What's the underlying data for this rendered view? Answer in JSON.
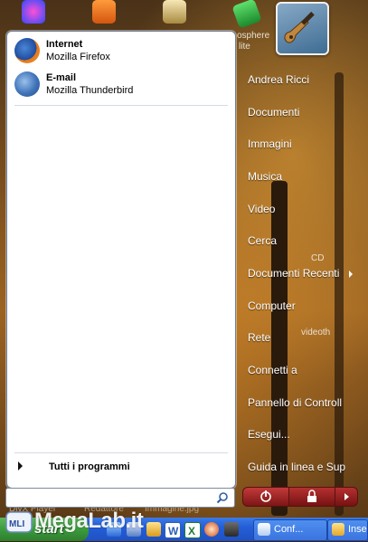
{
  "desktop": {
    "labels": {
      "biosphere": "osphere",
      "biosphere2": "lite",
      "cd": "CD",
      "videoth": "videoth",
      "divx": "DivX Player",
      "redattore": "Redattore",
      "immagine": "Immagine.jpg"
    }
  },
  "start_menu": {
    "pinned": [
      {
        "title": "Internet",
        "subtitle": "Mozilla Firefox",
        "icon": "firefox-icon"
      },
      {
        "title": "E-mail",
        "subtitle": "Mozilla Thunderbird",
        "icon": "thunderbird-icon"
      }
    ],
    "all_programs_label": "Tutti i programmi",
    "search": {
      "value": "",
      "placeholder": ""
    },
    "right_items": [
      {
        "label": "Andrea Ricci"
      },
      {
        "label": "Documenti"
      },
      {
        "label": "Immagini"
      },
      {
        "label": "Musica"
      },
      {
        "label": "Video"
      },
      {
        "label": "Cerca"
      },
      {
        "label": "Documenti Recenti"
      },
      {
        "label": "Computer"
      },
      {
        "label": "Rete"
      },
      {
        "label": "Connetti a"
      },
      {
        "label": "Pannello di Controll"
      },
      {
        "label": "Esegui..."
      },
      {
        "label": "Guida in linea e Sup"
      }
    ]
  },
  "taskbar": {
    "start_label": "start",
    "tasks": [
      {
        "label": "Conf...",
        "icon": "settings-window-icon"
      },
      {
        "label": "Inse",
        "icon": "folder-icon"
      }
    ]
  },
  "watermark": {
    "text": "MegaLab.it",
    "badge": "MLI"
  },
  "colors": {
    "menu_bg": "#ffffff",
    "taskbar_blue": "#245ed8",
    "start_green": "#3c9b3c",
    "power_red": "#9b2020"
  }
}
